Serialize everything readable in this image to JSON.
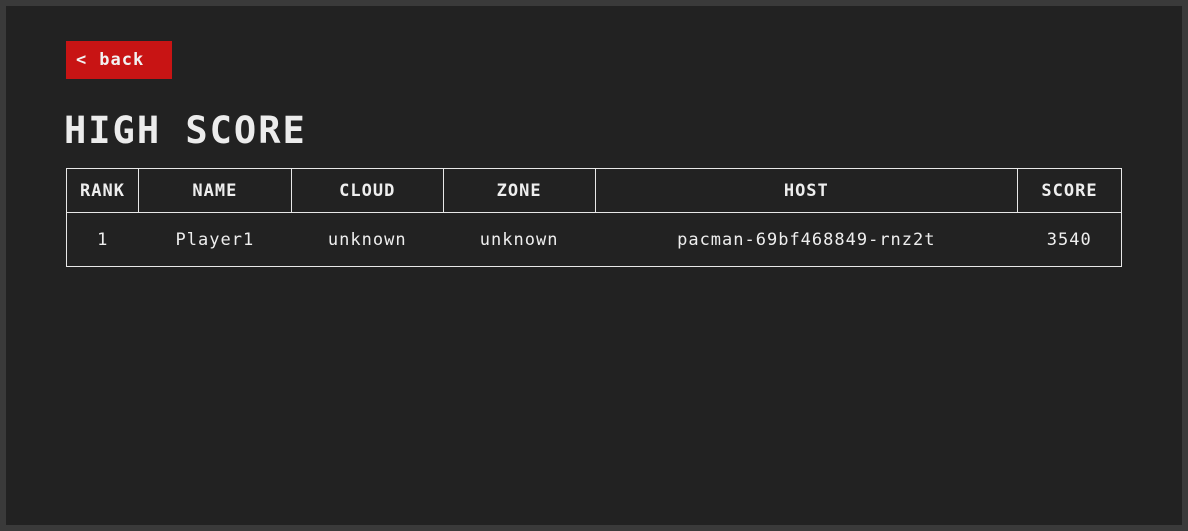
{
  "nav": {
    "back_icon": "chevron-left-icon",
    "back_icon_glyph": "<",
    "back_label": "back",
    "back_color": "#c81414"
  },
  "page": {
    "title": "HIGH SCORE"
  },
  "table": {
    "headers": [
      "RANK",
      "NAME",
      "CLOUD",
      "ZONE",
      "HOST",
      "SCORE"
    ],
    "rows": [
      {
        "rank": "1",
        "name": "Player1",
        "cloud": "unknown",
        "zone": "unknown",
        "host": "pacman-69bf468849-rnz2t",
        "score": "3540"
      }
    ]
  }
}
